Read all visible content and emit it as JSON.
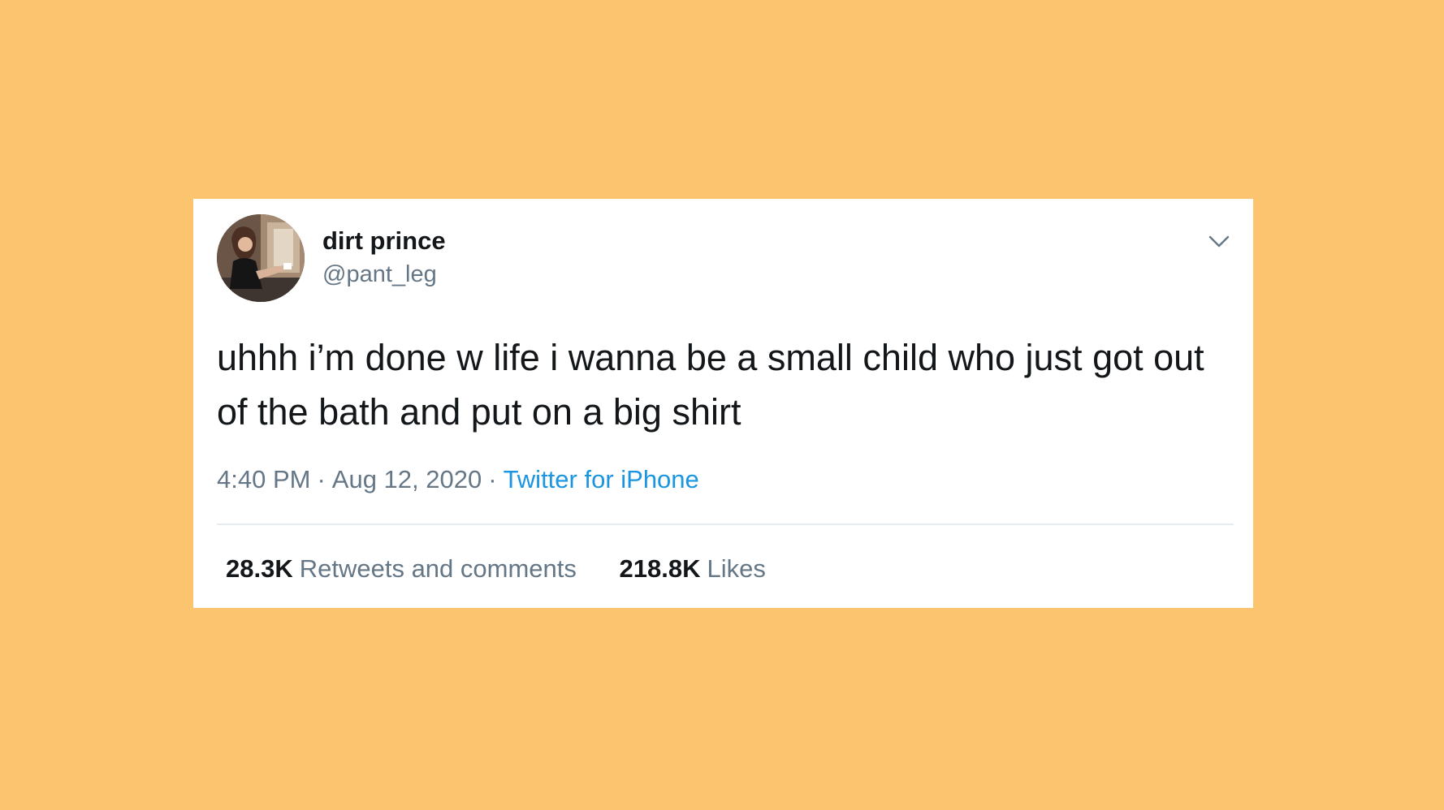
{
  "colors": {
    "background": "#fdc46f",
    "card": "#ffffff",
    "primary_text": "#14171a",
    "secondary_text": "#657786",
    "link": "#1b95e0",
    "divider": "#e6ecf0"
  },
  "author": {
    "display_name": "dirt prince",
    "handle": "@pant_leg",
    "avatar_icon": "profile-photo"
  },
  "menu_icon": "chevron-down-icon",
  "tweet": {
    "text": "uhhh i’m done w life i wanna be a small child who just got out of the bath and put on a big shirt",
    "time": "4:40 PM",
    "date": "Aug 12, 2020",
    "separator": "·",
    "source": "Twitter for iPhone"
  },
  "stats": {
    "retweets_count": "28.3K",
    "retweets_label": "Retweets and comments",
    "likes_count": "218.8K",
    "likes_label": "Likes"
  }
}
